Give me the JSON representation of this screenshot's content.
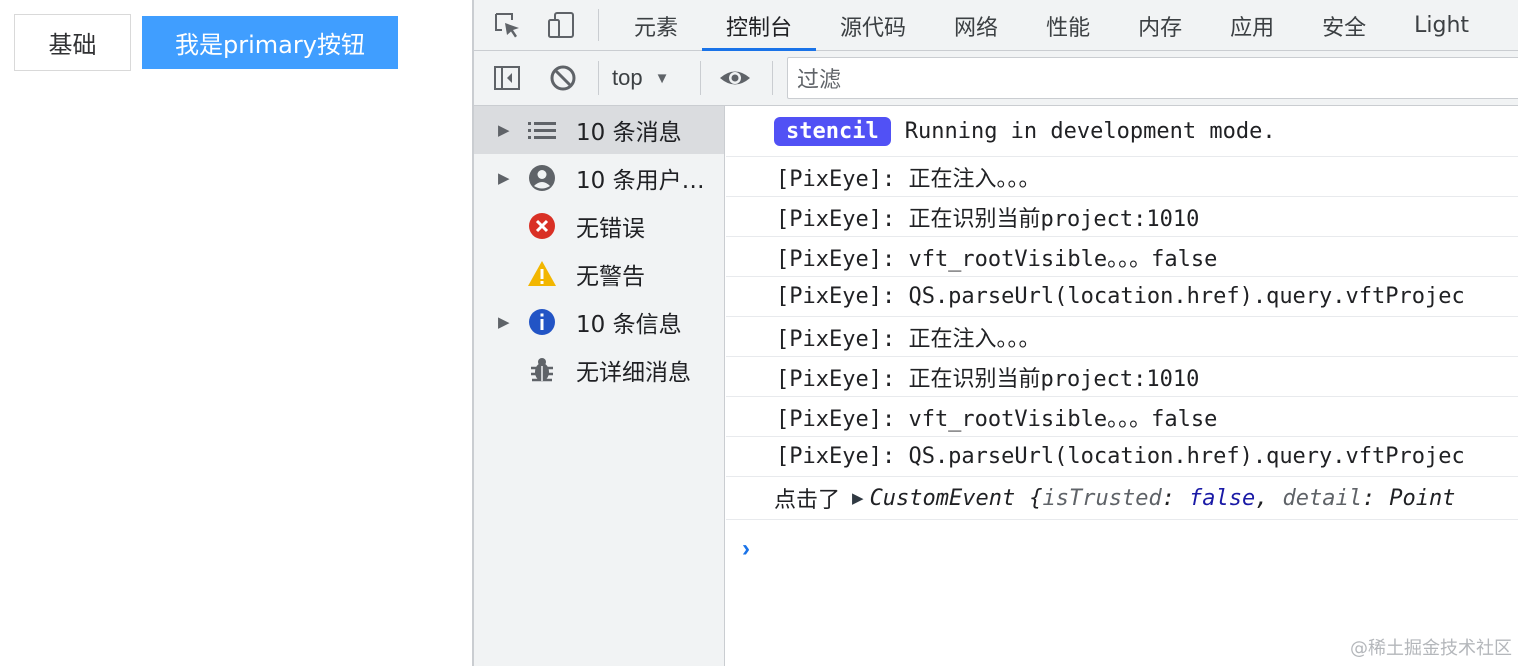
{
  "page": {
    "default_button": "基础",
    "primary_button": "我是primary按钮"
  },
  "devtools": {
    "tabs": [
      "元素",
      "控制台",
      "源代码",
      "网络",
      "性能",
      "内存",
      "应用",
      "安全",
      "Light"
    ],
    "active_tab": "控制台",
    "toolbar": {
      "context": "top",
      "filter_placeholder": "过滤"
    },
    "sidebar": [
      {
        "label": "10 条消息",
        "icon": "list-icon",
        "expandable": true,
        "active": true
      },
      {
        "label": "10 条用户…",
        "icon": "user-icon",
        "expandable": true,
        "active": false
      },
      {
        "label": "无错误",
        "icon": "error-icon",
        "expandable": false,
        "active": false
      },
      {
        "label": "无警告",
        "icon": "warning-icon",
        "expandable": false,
        "active": false
      },
      {
        "label": "10 条信息",
        "icon": "info-icon",
        "expandable": true,
        "active": false
      },
      {
        "label": "无详细消息",
        "icon": "bug-icon",
        "expandable": false,
        "active": false
      }
    ],
    "console": {
      "badge": "stencil",
      "first_message": "Running in development mode.",
      "messages": [
        "[PixEye]: 正在注入。。。",
        "[PixEye]: 正在识别当前project:1010",
        "[PixEye]: vft_rootVisible。。。false",
        "[PixEye]: QS.parseUrl(location.href).query.vftProjec",
        "[PixEye]: 正在注入。。。",
        "[PixEye]: 正在识别当前project:1010",
        "[PixEye]: vft_rootVisible。。。false",
        "[PixEye]: QS.parseUrl(location.href).query.vftProjec"
      ],
      "event": {
        "prefix": "点击了",
        "type": "CustomEvent",
        "open_brace": "{",
        "key1": "isTrusted",
        "colon": ":",
        "val1": "false",
        "comma": ",",
        "key2": "detail",
        "val2": "Point"
      },
      "prompt": "›"
    }
  },
  "watermark": "@稀土掘金技术社区",
  "colors": {
    "primary": "#409eff",
    "active_tab_underline": "#1a73e8",
    "badge": "#5151f5"
  }
}
